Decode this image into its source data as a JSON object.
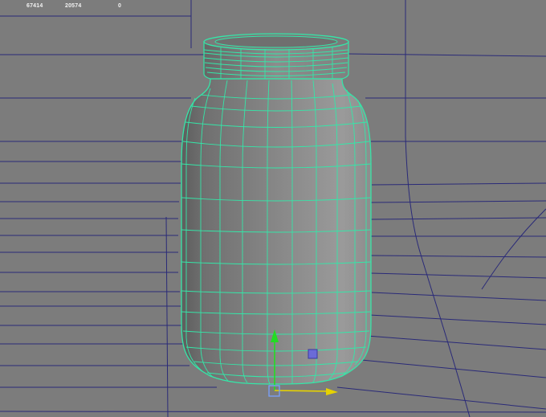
{
  "hud": {
    "poly_count": "67414",
    "vertex_count": "20574",
    "selected_count": "0"
  },
  "colors": {
    "background_floor": "#7e7e7e",
    "background_wall": "#8a8a8a",
    "grid_line": "#2a2a78",
    "wireframe": "#35e6a8",
    "jar_shade_dark": "#5a5a5a",
    "jar_shade_light": "#9c9c9c",
    "manip_y": "#22dd22",
    "manip_x": "#e6d200",
    "manip_z": "#3a3ad0"
  },
  "icons": [
    "move-y-arrow-icon",
    "move-x-arrow-icon",
    "move-z-handle-icon",
    "center-handle-icon"
  ]
}
